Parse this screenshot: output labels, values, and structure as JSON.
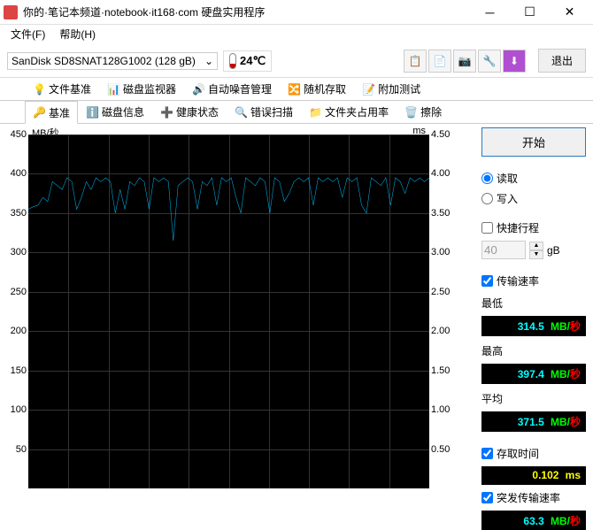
{
  "window": {
    "title": "你的·笔记本频道·notebook·it168·com 硬盘实用程序",
    "menu": {
      "file": "文件(F)",
      "help": "帮助(H)"
    }
  },
  "toolbar": {
    "drive": "SanDisk SD8SNAT128G1002 (128 gB)",
    "temperature": "24℃",
    "exit": "退出"
  },
  "tabs_top": [
    {
      "label": "文件基准",
      "icon": "file-bench-icon"
    },
    {
      "label": "磁盘监视器",
      "icon": "monitor-icon"
    },
    {
      "label": "自动噪音管理",
      "icon": "speaker-icon"
    },
    {
      "label": "随机存取",
      "icon": "random-icon"
    },
    {
      "label": "附加测试",
      "icon": "extra-icon"
    }
  ],
  "tabs_bottom": [
    {
      "label": "基准",
      "icon": "bench-icon",
      "active": true
    },
    {
      "label": "磁盘信息",
      "icon": "info-icon"
    },
    {
      "label": "健康状态",
      "icon": "health-icon"
    },
    {
      "label": "错误扫描",
      "icon": "scan-icon"
    },
    {
      "label": "文件夹占用率",
      "icon": "folder-icon"
    },
    {
      "label": "擦除",
      "icon": "erase-icon"
    }
  ],
  "chart_data": {
    "type": "line",
    "title": "",
    "ylabel_left": "MB/秒",
    "ylabel_right": "ms",
    "y_left_ticks": [
      450,
      400,
      350,
      300,
      250,
      200,
      150,
      100,
      50
    ],
    "y_right_ticks": [
      4.5,
      4.0,
      3.5,
      3.0,
      2.5,
      2.0,
      1.5,
      1.0,
      0.5
    ],
    "ylim_left": [
      0,
      450
    ],
    "ylim_right": [
      0,
      4.5
    ],
    "series": [
      {
        "name": "读取",
        "color": "#00bfff",
        "values": [
          355,
          358,
          360,
          370,
          365,
          390,
          385,
          380,
          395,
          390,
          355,
          370,
          390,
          380,
          395,
          390,
          395,
          390,
          350,
          380,
          355,
          390,
          385,
          395,
          390,
          355,
          395,
          390,
          395,
          390,
          315,
          385,
          390,
          395,
          390,
          355,
          390,
          385,
          395,
          360,
          395,
          390,
          395,
          370,
          350,
          395,
          390,
          385,
          395,
          390,
          350,
          395,
          390,
          365,
          375,
          390,
          395,
          390,
          395,
          360,
          395,
          390,
          395,
          390,
          395,
          370,
          395,
          390,
          395,
          360,
          350,
          395,
          390,
          385,
          395,
          360,
          395,
          390,
          375,
          395,
          390,
          395,
          390,
          395
        ]
      }
    ]
  },
  "controls": {
    "start": "开始",
    "read": "读取",
    "write": "写入",
    "shortstroke": "快捷行程",
    "stroke_value": "40",
    "stroke_unit": "gB",
    "transfer_rate": "传输速率",
    "min_label": "最低",
    "min_value": "314.5",
    "max_label": "最高",
    "max_value": "397.4",
    "avg_label": "平均",
    "avg_value": "371.5",
    "mb_unit": "MB/",
    "sec_unit": "秒",
    "access_time": "存取时间",
    "access_value": "0.102",
    "ms_unit": "ms",
    "burst_rate": "突发传输速率",
    "burst_value": "63.3"
  }
}
